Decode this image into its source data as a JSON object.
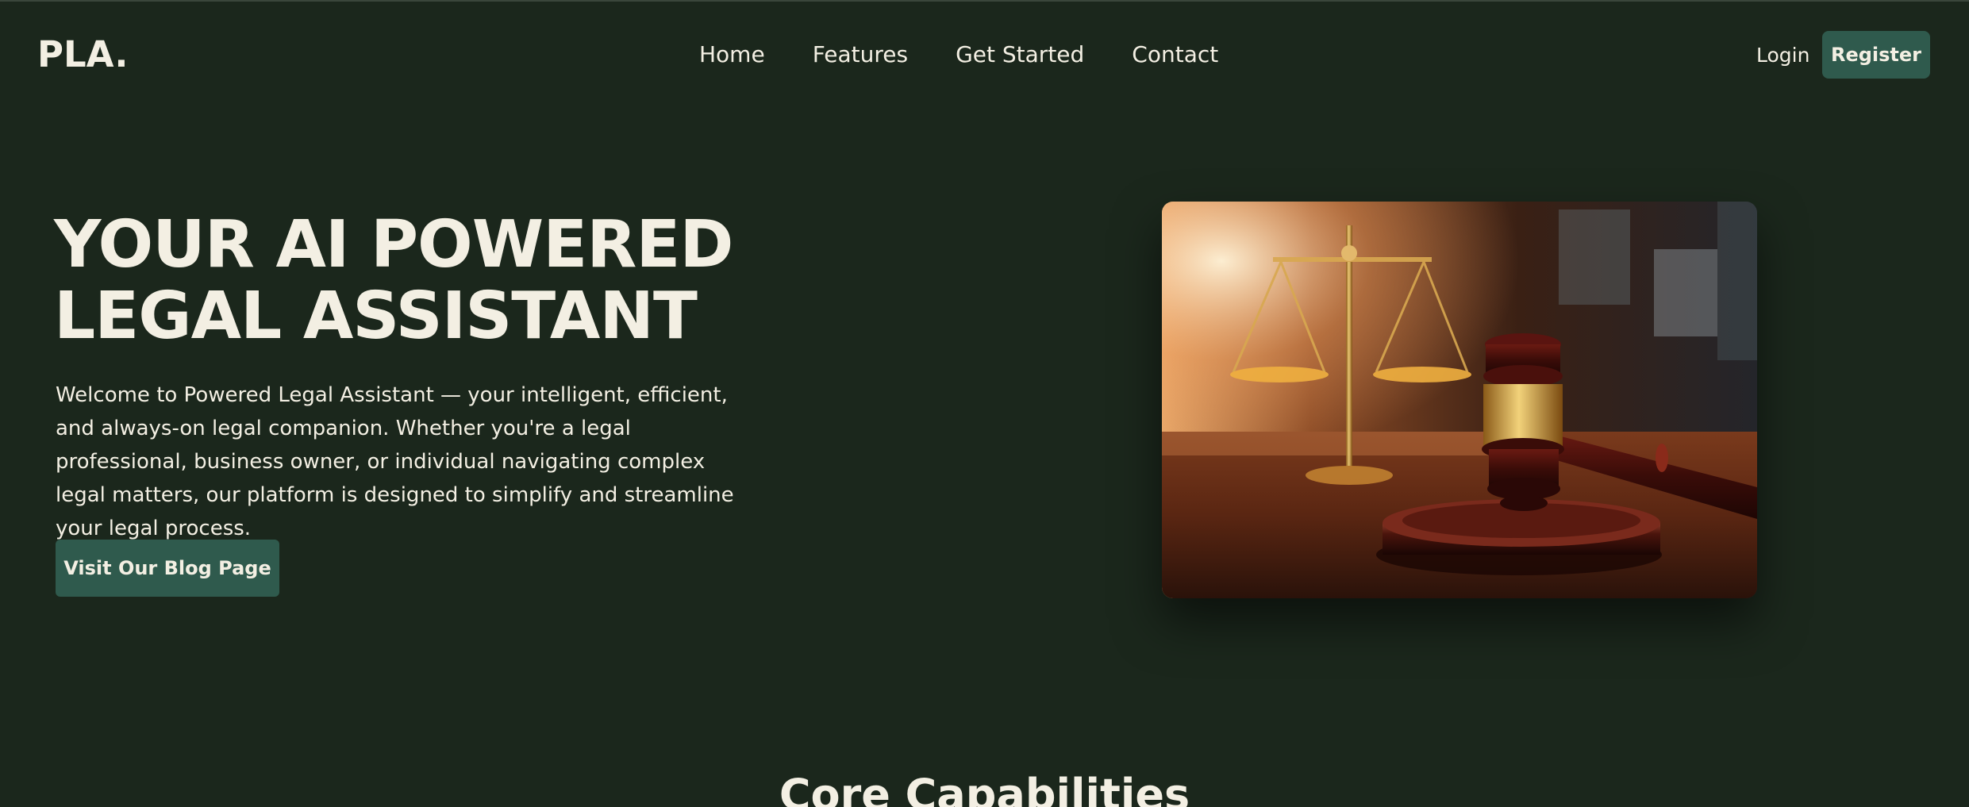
{
  "navbar": {
    "logo": "PLA.",
    "links": [
      {
        "label": "Home"
      },
      {
        "label": "Features"
      },
      {
        "label": "Get Started"
      },
      {
        "label": "Contact"
      }
    ],
    "login_label": "Login",
    "register_label": "Register"
  },
  "hero": {
    "title_line1": "YOUR AI POWERED",
    "title_line2": "LEGAL ASSISTANT",
    "description": "Welcome to Powered Legal Assistant — your intelligent, efficient, and always-on legal companion. Whether you're a legal professional, business owner, or individual navigating complex legal matters, our platform is designed to simplify and streamline your legal process.",
    "cta_label": "Visit Our Blog Page",
    "image_icon": "gavel-and-scales-photo"
  },
  "core": {
    "heading": "Core Capabilities"
  },
  "colors": {
    "background": "#1b271c",
    "text": "#f3efe3",
    "accent": "#2f5a4d"
  }
}
